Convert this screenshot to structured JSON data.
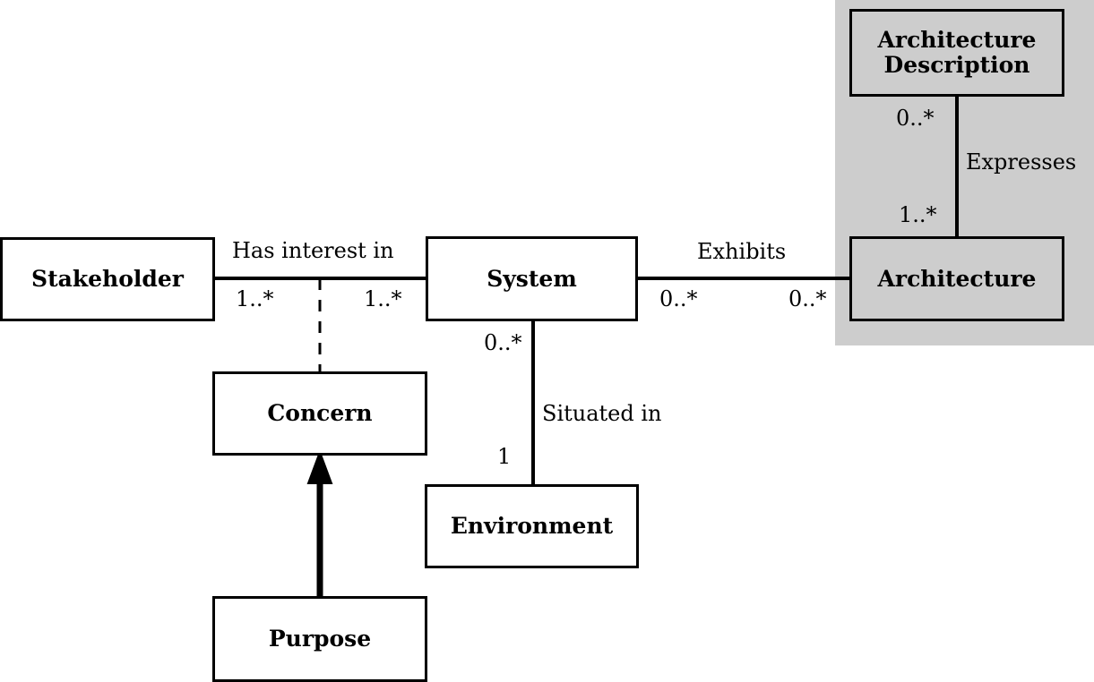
{
  "diagram": {
    "type": "uml-class-diagram",
    "background_color": "#ffffff",
    "shaded_region_color": "#cdcdcd",
    "line_color": "#000000",
    "nodes": [
      {
        "id": "stakeholder",
        "label": "Stakeholder",
        "shaded": false
      },
      {
        "id": "system",
        "label": "System",
        "shaded": false
      },
      {
        "id": "concern",
        "label": "Concern",
        "shaded": false
      },
      {
        "id": "purpose",
        "label": "Purpose",
        "shaded": false
      },
      {
        "id": "environment",
        "label": "Environment",
        "shaded": false
      },
      {
        "id": "architecture",
        "label": "Architecture",
        "shaded": true
      },
      {
        "id": "architecture-description",
        "label": "Architecture\nDescription",
        "shaded": true
      }
    ],
    "edges": [
      {
        "id": "has-interest-in",
        "label": "Has interest in",
        "from": "stakeholder",
        "to": "system",
        "source_multiplicity": "1..*",
        "target_multiplicity": "1..*",
        "style": "solid"
      },
      {
        "id": "concern-link",
        "label": "",
        "from": "has-interest-in",
        "to": "concern",
        "source_multiplicity": "",
        "target_multiplicity": "",
        "style": "dashed"
      },
      {
        "id": "exhibits",
        "label": "Exhibits",
        "from": "system",
        "to": "architecture",
        "source_multiplicity": "0..*",
        "target_multiplicity": "0..*",
        "style": "solid"
      },
      {
        "id": "situated-in",
        "label": "Situated in",
        "from": "system",
        "to": "environment",
        "source_multiplicity": "0..*",
        "target_multiplicity": "1",
        "style": "solid"
      },
      {
        "id": "expresses",
        "label": "Expresses",
        "from": "architecture-description",
        "to": "architecture",
        "source_multiplicity": "0..*",
        "target_multiplicity": "1..*",
        "style": "solid"
      },
      {
        "id": "purpose-is-a-concern",
        "label": "",
        "from": "purpose",
        "to": "concern",
        "source_multiplicity": "",
        "target_multiplicity": "",
        "style": "generalization-arrow"
      }
    ]
  },
  "labels": {
    "stakeholder": "Stakeholder",
    "system": "System",
    "concern": "Concern",
    "purpose": "Purpose",
    "environment": "Environment",
    "architecture": "Architecture",
    "architecture_description_line1": "Architecture",
    "architecture_description_line2": "Description",
    "has_interest_in": "Has interest in",
    "exhibits": "Exhibits",
    "situated_in": "Situated in",
    "expresses": "Expresses"
  },
  "multiplicities": {
    "stakeholder_side": "1..*",
    "system_side_interest": "1..*",
    "system_side_exhibits": "0..*",
    "architecture_side_exhibits": "0..*",
    "system_side_situated": "0..*",
    "environment_side_situated": "1",
    "ad_side_expresses": "0..*",
    "architecture_side_expresses": "1..*"
  }
}
